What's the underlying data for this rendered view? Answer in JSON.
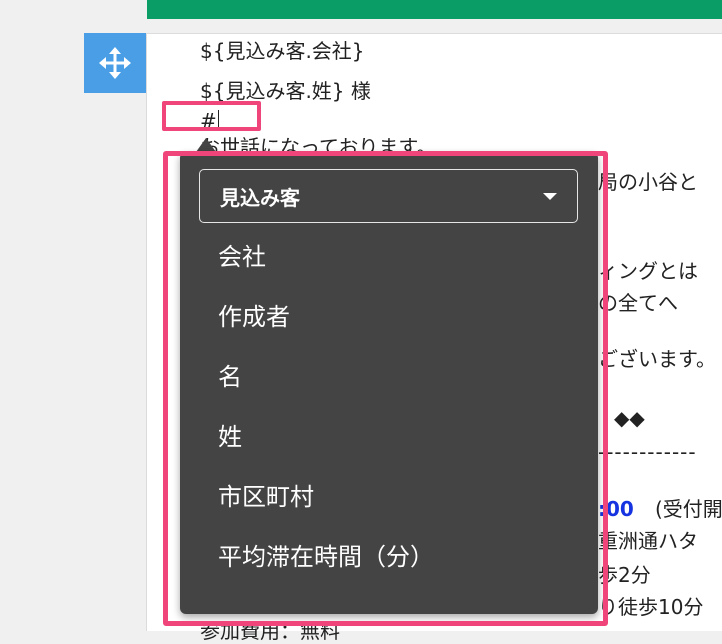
{
  "editor": {
    "lines": [
      "${見込み客.会社}",
      "${見込み客.姓} 様",
      "#",
      "お世話になっております。",
      "局の小谷と",
      "ィングとは",
      "の全てへ",
      "ございます。",
      "◆◆",
      "------------",
      ":00",
      "(受付開",
      "重洲通ハタ",
      "歩2分",
      "り徒歩10分",
      "参加費用：無料"
    ]
  },
  "dropdown": {
    "selected": "見込み客",
    "options": [
      "会社",
      "作成者",
      "名",
      "姓",
      "市区町村",
      "平均滞在時間（分）"
    ]
  },
  "colors": {
    "highlight": "#f0457a",
    "dropdown_bg": "#444444",
    "handle": "#4a9ee6",
    "top_bar": "#0a9e66",
    "time_text": "#1533e0"
  }
}
